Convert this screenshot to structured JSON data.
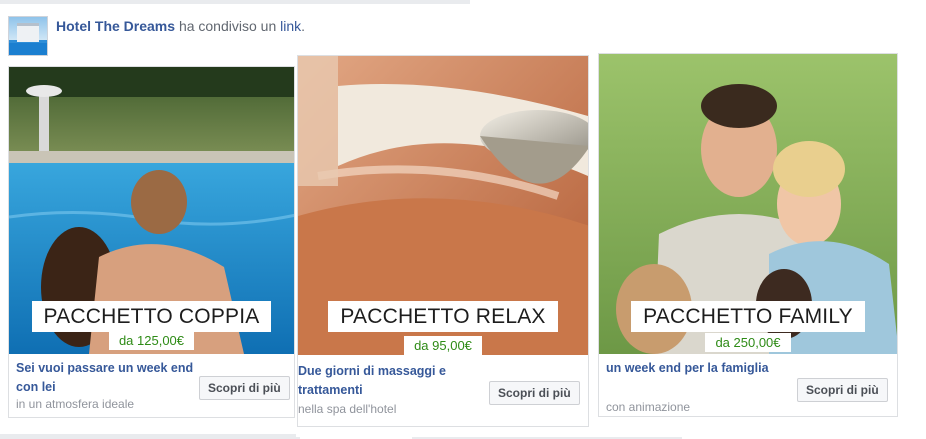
{
  "header": {
    "page_name": "Hotel The Dreams",
    "action_text": "ha condiviso un",
    "link_text": "link",
    "period": "."
  },
  "cards": [
    {
      "title": "PACCHETTO COPPIA",
      "price": "da 125,00€",
      "description": "Sei vuoi passare un week end con lei",
      "subtitle": "in un atmosfera ideale",
      "button": "Scopri di più"
    },
    {
      "title": "PACCHETTO RELAX",
      "price": "da 95,00€",
      "description": "Due giorni di massaggi e trattamenti",
      "subtitle": "nella spa dell'hotel",
      "button": "Scopri di più"
    },
    {
      "title": "PACCHETTO FAMILY",
      "price": "da 250,00€",
      "description": "un week end per la famiglia",
      "subtitle": "con animazione",
      "button": "Scopri di più"
    }
  ],
  "colors": {
    "link_blue": "#365899",
    "price_green": "#2e8b16",
    "muted_gray": "#90949c"
  }
}
